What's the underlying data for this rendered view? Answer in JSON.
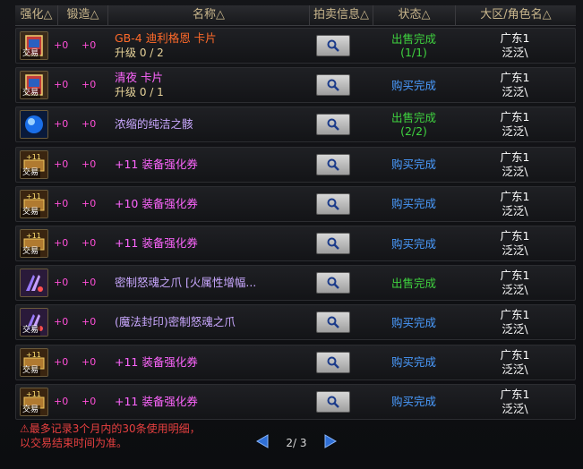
{
  "header": {
    "cols": [
      "强化△",
      "锻造△",
      "名称△",
      "拍卖信息△",
      "状态△",
      "大区/角色名△"
    ]
  },
  "rows": [
    {
      "icon": "card-icon",
      "tag": "交易",
      "enhance": "+0",
      "forge": "+0",
      "name": "GB-4 迪利格恩 卡片",
      "name_color": "#ff6a2a",
      "level": "升级 0 / 2",
      "status": "出售完成",
      "status_sub": "(1/1)",
      "status_color": "#3fd23f",
      "region": "广东1",
      "role": "泛泛\\"
    },
    {
      "icon": "card-icon",
      "tag": "交易",
      "enhance": "+0",
      "forge": "+0",
      "name": "清夜 卡片",
      "name_color": "#ff66ff",
      "level": "升级 0 / 1",
      "status": "购买完成",
      "status_sub": "",
      "status_color": "#4a9cff",
      "region": "广东1",
      "role": "泛泛\\"
    },
    {
      "icon": "orb-icon",
      "tag": "",
      "enhance": "+0",
      "forge": "+0",
      "name": "浓缩的纯洁之骸",
      "name_color": "#c9a8ff",
      "level": "",
      "status": "出售完成",
      "status_sub": "(2/2)",
      "status_color": "#3fd23f",
      "region": "广东1",
      "role": "泛泛\\"
    },
    {
      "icon": "ticket-icon",
      "tag": "交易",
      "enhance": "+0",
      "forge": "+0",
      "name": "+11 装备强化券",
      "name_color": "#ff66ff",
      "level": "",
      "status": "购买完成",
      "status_sub": "",
      "status_color": "#4a9cff",
      "region": "广东1",
      "role": "泛泛\\"
    },
    {
      "icon": "ticket-icon",
      "tag": "交易",
      "enhance": "+0",
      "forge": "+0",
      "name": "+10 装备强化券",
      "name_color": "#ff66ff",
      "level": "",
      "status": "购买完成",
      "status_sub": "",
      "status_color": "#4a9cff",
      "region": "广东1",
      "role": "泛泛\\"
    },
    {
      "icon": "ticket-icon",
      "tag": "交易",
      "enhance": "+0",
      "forge": "+0",
      "name": "+11 装备强化券",
      "name_color": "#ff66ff",
      "level": "",
      "status": "购买完成",
      "status_sub": "",
      "status_color": "#4a9cff",
      "region": "广东1",
      "role": "泛泛\\"
    },
    {
      "icon": "claw-icon",
      "tag": "",
      "enhance": "+0",
      "forge": "+0",
      "name": "密制怒魂之爪 [火属性增幅...",
      "name_color": "#c9a8ff",
      "level": "",
      "status": "出售完成",
      "status_sub": "",
      "status_color": "#3fd23f",
      "region": "广东1",
      "role": "泛泛\\"
    },
    {
      "icon": "claw-icon",
      "tag": "交易",
      "enhance": "+0",
      "forge": "+0",
      "name": "(魔法封印)密制怒魂之爪",
      "name_color": "#c9a8ff",
      "level": "",
      "status": "购买完成",
      "status_sub": "",
      "status_color": "#4a9cff",
      "region": "广东1",
      "role": "泛泛\\"
    },
    {
      "icon": "ticket-icon",
      "tag": "交易",
      "enhance": "+0",
      "forge": "+0",
      "name": "+11 装备强化券",
      "name_color": "#ff66ff",
      "level": "",
      "status": "购买完成",
      "status_sub": "",
      "status_color": "#4a9cff",
      "region": "广东1",
      "role": "泛泛\\"
    },
    {
      "icon": "ticket-icon",
      "tag": "交易",
      "enhance": "+0",
      "forge": "+0",
      "name": "+11 装备强化券",
      "name_color": "#ff66ff",
      "level": "",
      "status": "购买完成",
      "status_sub": "",
      "status_color": "#4a9cff",
      "region": "广东1",
      "role": "泛泛\\"
    }
  ],
  "footer": {
    "note": "⚠最多记录3个月内的30条使用明细，以交易结束时间为准。",
    "page": "2/ 3"
  },
  "colors": {
    "enhance": "#ff4fd8",
    "header_text": "#c9b68c",
    "note": "#e84040"
  }
}
